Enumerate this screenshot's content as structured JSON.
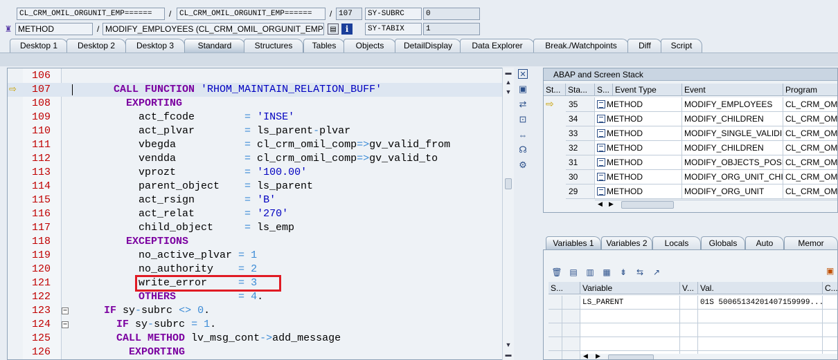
{
  "header": {
    "row1": {
      "class_field": "CL_CRM_OMIL_ORGUNIT_EMP======",
      "include_field": "CL_CRM_OMIL_ORGUNIT_EMP======",
      "line_field": "107",
      "sysvar_label": "SY-SUBRC",
      "sysvar_value": "0"
    },
    "row2": {
      "type_field": "METHOD",
      "method_field": "MODIFY_EMPLOYEES (CL_CRM_OMIL_ORGUNIT_EMP)",
      "sysvar_label": "SY-TABIX",
      "sysvar_value": "1"
    },
    "separator": "/"
  },
  "tabs": [
    "Desktop 1",
    "Desktop 2",
    "Desktop 3",
    "Standard",
    "Structures",
    "Tables",
    "Objects",
    "DetailDisplay",
    "Data Explorer",
    "Break./Watchpoints",
    "Diff",
    "Script"
  ],
  "active_tab": "Standard",
  "editor": {
    "current_line": "107",
    "lines": [
      {
        "n": "106",
        "parts": []
      },
      {
        "n": "107",
        "parts": [
          [
            "kw",
            "CALL FUNCTION"
          ],
          [
            "t",
            " "
          ],
          [
            "str",
            "'RHOM_MAINTAIN_RELATION_BUFF'"
          ]
        ]
      },
      {
        "n": "108",
        "parts": [
          [
            "t",
            "  "
          ],
          [
            "kw",
            "EXPORTING"
          ]
        ]
      },
      {
        "n": "109",
        "parts": [
          [
            "t",
            "    act_fcode        "
          ],
          [
            "op",
            "="
          ],
          [
            "t",
            " "
          ],
          [
            "str",
            "'INSE'"
          ]
        ]
      },
      {
        "n": "110",
        "parts": [
          [
            "t",
            "    act_plvar        "
          ],
          [
            "op",
            "="
          ],
          [
            "t",
            " ls_parent"
          ],
          [
            "op",
            "-"
          ],
          [
            "t",
            "plvar"
          ]
        ]
      },
      {
        "n": "111",
        "parts": [
          [
            "t",
            "    vbegda           "
          ],
          [
            "op",
            "="
          ],
          [
            "t",
            " cl_crm_omil_comp"
          ],
          [
            "op",
            "=>"
          ],
          [
            "t",
            "gv_valid_from"
          ]
        ]
      },
      {
        "n": "112",
        "parts": [
          [
            "t",
            "    vendda           "
          ],
          [
            "op",
            "="
          ],
          [
            "t",
            " cl_crm_omil_comp"
          ],
          [
            "op",
            "=>"
          ],
          [
            "t",
            "gv_valid_to"
          ]
        ]
      },
      {
        "n": "113",
        "parts": [
          [
            "t",
            "    vprozt           "
          ],
          [
            "op",
            "="
          ],
          [
            "t",
            " "
          ],
          [
            "str",
            "'100.00'"
          ]
        ]
      },
      {
        "n": "114",
        "parts": [
          [
            "t",
            "    parent_object    "
          ],
          [
            "op",
            "="
          ],
          [
            "t",
            " ls_parent"
          ]
        ]
      },
      {
        "n": "115",
        "parts": [
          [
            "t",
            "    act_rsign        "
          ],
          [
            "op",
            "="
          ],
          [
            "t",
            " "
          ],
          [
            "str",
            "'B'"
          ]
        ]
      },
      {
        "n": "116",
        "parts": [
          [
            "t",
            "    act_relat        "
          ],
          [
            "op",
            "="
          ],
          [
            "t",
            " "
          ],
          [
            "str",
            "'270'"
          ]
        ]
      },
      {
        "n": "117",
        "parts": [
          [
            "t",
            "    child_object     "
          ],
          [
            "op",
            "="
          ],
          [
            "t",
            " ls_emp"
          ]
        ]
      },
      {
        "n": "118",
        "parts": [
          [
            "t",
            "  "
          ],
          [
            "kw",
            "EXCEPTIONS"
          ]
        ]
      },
      {
        "n": "119",
        "parts": [
          [
            "t",
            "    no_active_plvar "
          ],
          [
            "op",
            "="
          ],
          [
            "t",
            " "
          ],
          [
            "num",
            "1"
          ]
        ]
      },
      {
        "n": "120",
        "parts": [
          [
            "t",
            "    no_authority    "
          ],
          [
            "op",
            "="
          ],
          [
            "t",
            " "
          ],
          [
            "num",
            "2"
          ]
        ]
      },
      {
        "n": "121",
        "parts": [
          [
            "t",
            "    write_error     "
          ],
          [
            "op",
            "="
          ],
          [
            "t",
            " "
          ],
          [
            "num",
            "3"
          ]
        ]
      },
      {
        "n": "122",
        "parts": [
          [
            "t",
            "    "
          ],
          [
            "kw",
            "OTHERS"
          ],
          [
            "t",
            "          "
          ],
          [
            "op",
            "="
          ],
          [
            "t",
            " "
          ],
          [
            "num",
            "4"
          ],
          [
            "t",
            "."
          ]
        ]
      },
      {
        "n": "123",
        "parts": [
          [
            "kw",
            "IF"
          ],
          [
            "t",
            " sy"
          ],
          [
            "op",
            "-"
          ],
          [
            "t",
            "subrc "
          ],
          [
            "op",
            "<>"
          ],
          [
            "t",
            " "
          ],
          [
            "num",
            "0"
          ],
          [
            "t",
            "."
          ]
        ]
      },
      {
        "n": "124",
        "parts": [
          [
            "t",
            "  "
          ],
          [
            "kw",
            "IF"
          ],
          [
            "t",
            " sy"
          ],
          [
            "op",
            "-"
          ],
          [
            "t",
            "subrc "
          ],
          [
            "op",
            "="
          ],
          [
            "t",
            " "
          ],
          [
            "num",
            "1"
          ],
          [
            "t",
            "."
          ]
        ]
      },
      {
        "n": "125",
        "parts": [
          [
            "t",
            "  "
          ],
          [
            "kw",
            "CALL METHOD"
          ],
          [
            "t",
            " lv_msg_cont"
          ],
          [
            "op",
            "->"
          ],
          [
            "t",
            "add_message"
          ]
        ]
      },
      {
        "n": "126",
        "parts": [
          [
            "t",
            "    "
          ],
          [
            "kw",
            "EXPORTING"
          ]
        ]
      }
    ]
  },
  "stack": {
    "title": "ABAP and Screen Stack",
    "columns": [
      "St...",
      "Sta...",
      "S...",
      "Event Type",
      "Event",
      "Program"
    ],
    "rows": [
      {
        "level": "35",
        "type": "METHOD",
        "event": "MODIFY_EMPLOYEES",
        "program": "CL_CRM_OMIL_",
        "current": true
      },
      {
        "level": "34",
        "type": "METHOD",
        "event": "MODIFY_CHILDREN",
        "program": "CL_CRM_OMIL_",
        "current": false
      },
      {
        "level": "33",
        "type": "METHOD",
        "event": "MODIFY_SINGLE_VALIDI...",
        "program": "CL_CRM_OMIL_",
        "current": false
      },
      {
        "level": "32",
        "type": "METHOD",
        "event": "MODIFY_CHILDREN",
        "program": "CL_CRM_OMIL_",
        "current": false
      },
      {
        "level": "31",
        "type": "METHOD",
        "event": "MODIFY_OBJECTS_POSI...",
        "program": "CL_CRM_OMIL_",
        "current": false
      },
      {
        "level": "30",
        "type": "METHOD",
        "event": "MODIFY_ORG_UNIT_CHI...",
        "program": "CL_CRM_OMIL_",
        "current": false
      },
      {
        "level": "29",
        "type": "METHOD",
        "event": "MODIFY_ORG_UNIT",
        "program": "CL_CRM_OMIL_",
        "current": false
      }
    ]
  },
  "variables": {
    "tabs": [
      "Variables 1",
      "Variables 2",
      "Locals",
      "Globals",
      "Auto",
      "Memor"
    ],
    "active_tab": "Variables 1",
    "columns": [
      "S...",
      "Variable",
      "V...",
      "Val.",
      "C..."
    ],
    "rows": [
      {
        "variable": "LS_PARENT",
        "value": "01S 50065134201407159999..."
      }
    ]
  }
}
